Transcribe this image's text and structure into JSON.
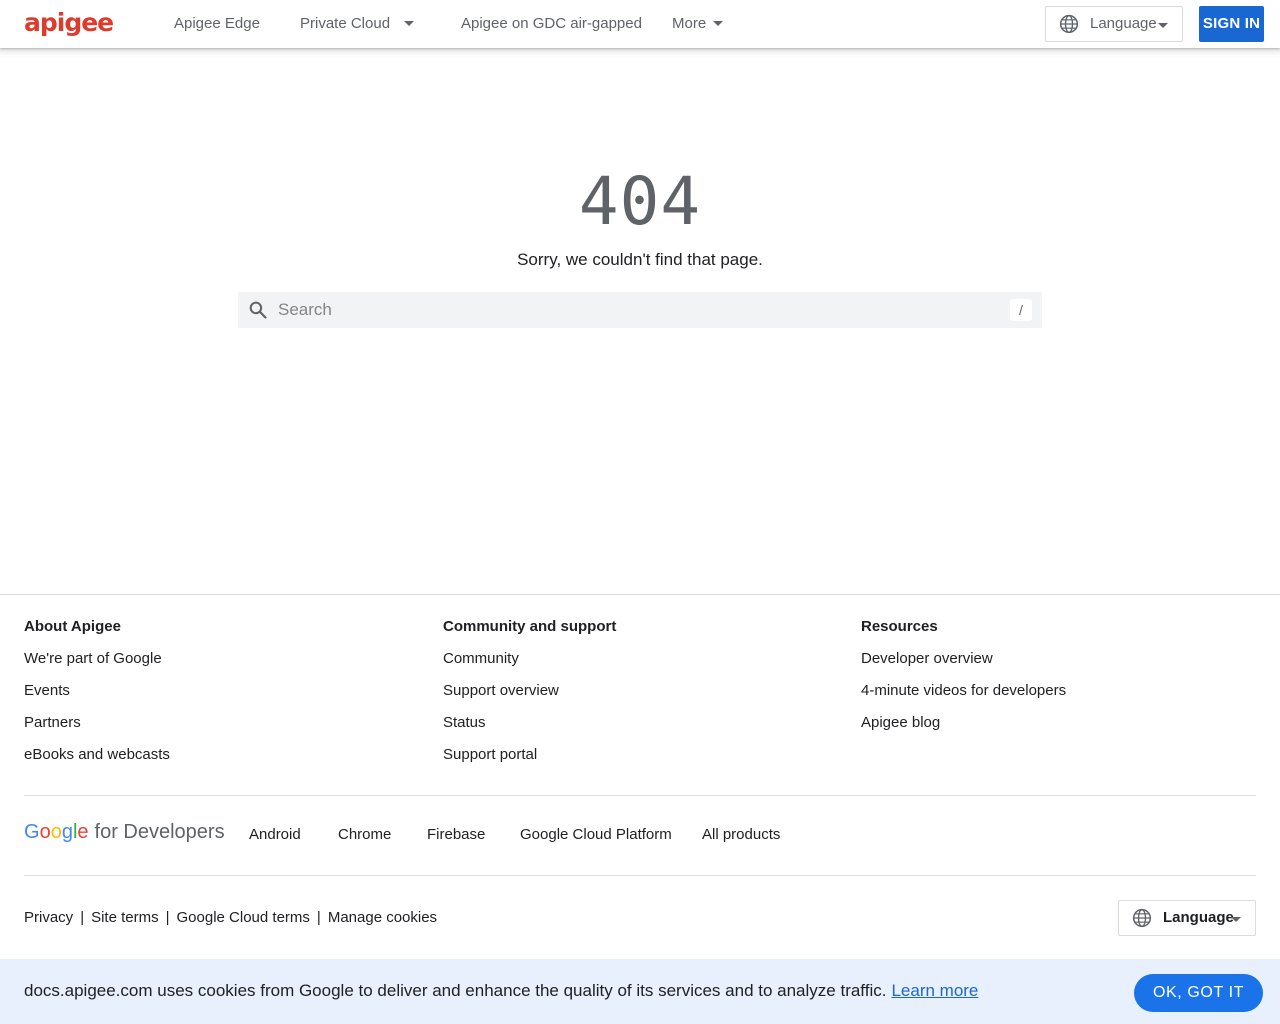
{
  "header": {
    "logo_text": "apigee",
    "nav": [
      {
        "label": "Apigee Edge"
      },
      {
        "label": "Private Cloud"
      },
      {
        "label": "Apigee on GDC air-gapped"
      },
      {
        "label": "More"
      }
    ],
    "language_label": "Language",
    "signin_label": "SIGN IN",
    "brand_color": "#dd3c2d",
    "accent_color": "#1967d2"
  },
  "main": {
    "error_code": "404",
    "error_message": "Sorry, we couldn't find that page.",
    "search_placeholder": "Search",
    "search_shortcut": "/"
  },
  "footer": {
    "columns": [
      {
        "title": "About Apigee",
        "links": [
          "We're part of Google",
          "Events",
          "Partners",
          "eBooks and webcasts"
        ]
      },
      {
        "title": "Community and support",
        "links": [
          "Community",
          "Support overview",
          "Status",
          "Support portal"
        ]
      },
      {
        "title": "Resources",
        "links": [
          "Developer overview",
          "4-minute videos for developers",
          "Apigee blog"
        ]
      }
    ],
    "brand": {
      "google": "Google",
      "for_developers": "for Developers"
    },
    "products": [
      "Android",
      "Chrome",
      "Firebase",
      "Google Cloud Platform",
      "All products"
    ],
    "legal": [
      "Privacy",
      "Site terms",
      "Google Cloud terms",
      "Manage cookies"
    ],
    "language_label": "Language"
  },
  "cookie": {
    "text": "docs.apigee.com uses cookies from Google to deliver and enhance the quality of its services and to analyze traffic.",
    "learn_more": "Learn more",
    "ok_label": "OK, GOT IT"
  }
}
